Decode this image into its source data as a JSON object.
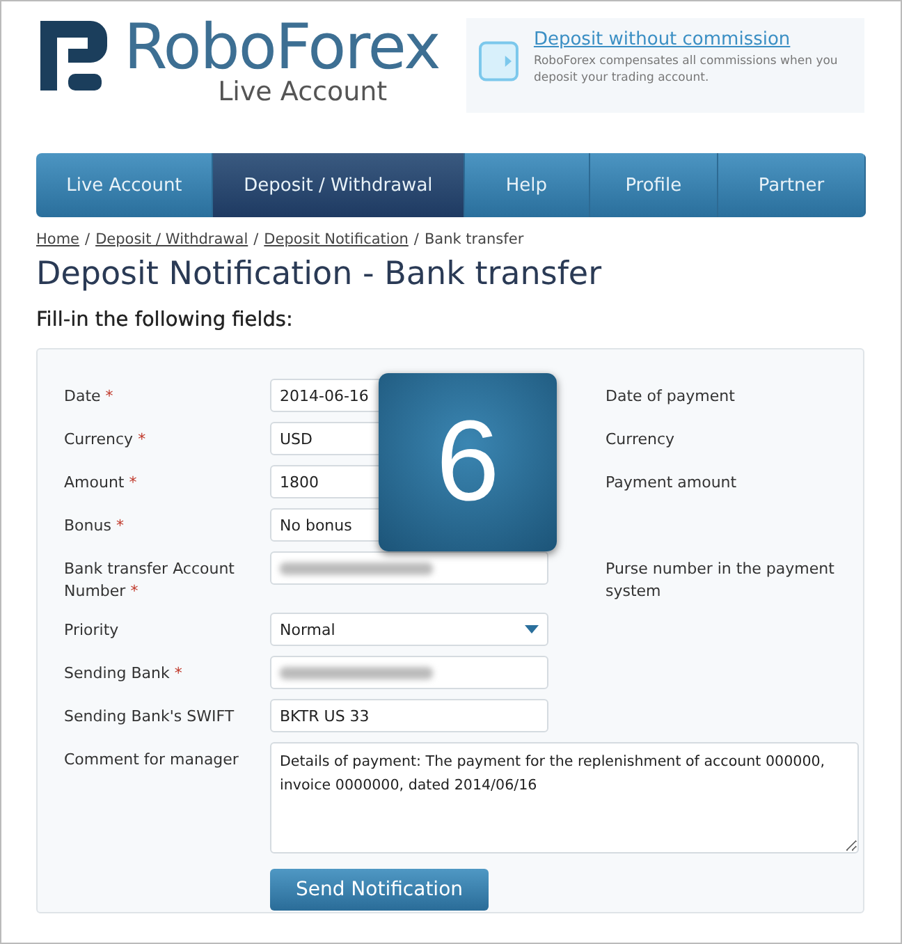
{
  "header": {
    "logo_title": "RoboForex",
    "logo_subtitle": "Live Account",
    "promo": {
      "title": "Deposit without commission",
      "text": "RoboForex compensates all commissions when you deposit your trading account."
    }
  },
  "nav": [
    {
      "label": "Live Account",
      "selected": false
    },
    {
      "label": "Deposit / Withdrawal",
      "selected": true
    },
    {
      "label": "Help",
      "selected": false
    },
    {
      "label": "Profile",
      "selected": false
    },
    {
      "label": "Partner",
      "selected": false
    }
  ],
  "breadcrumb": {
    "separator": "/",
    "items": [
      {
        "label": "Home",
        "link": true
      },
      {
        "label": "Deposit / Withdrawal",
        "link": true
      },
      {
        "label": "Deposit Notification",
        "link": true
      },
      {
        "label": "Bank transfer",
        "link": false
      }
    ]
  },
  "title": "Deposit Notification - Bank transfer",
  "subtitle": "Fill-in the following fields:",
  "form": {
    "required_mark": "*",
    "fields": [
      {
        "label": "Date",
        "required": true,
        "kind": "input",
        "value": "2014-06-16",
        "hint": "Date of payment"
      },
      {
        "label": "Currency",
        "required": true,
        "kind": "input",
        "value": "USD",
        "hint": "Currency"
      },
      {
        "label": "Amount",
        "required": true,
        "kind": "input",
        "value": "1800",
        "hint": "Payment amount"
      },
      {
        "label": "Bonus",
        "required": true,
        "kind": "input",
        "value": "No bonus"
      },
      {
        "label": "Bank transfer Account Number",
        "required": true,
        "kind": "redacted",
        "hint": "Purse number in the payment system"
      },
      {
        "label": "Priority",
        "required": false,
        "kind": "select",
        "value": "Normal"
      },
      {
        "label": "Sending Bank",
        "required": true,
        "kind": "redacted"
      },
      {
        "label": "Sending Bank's SWIFT",
        "required": false,
        "kind": "input",
        "value": "BKTR US 33"
      },
      {
        "label": "Comment for manager",
        "required": false,
        "kind": "textarea",
        "value": "Details of payment: The payment for the replenishment of account 000000, invoice 0000000, dated 2014/06/16"
      }
    ],
    "submit": "Send Notification"
  },
  "overlay_badge": "6"
}
